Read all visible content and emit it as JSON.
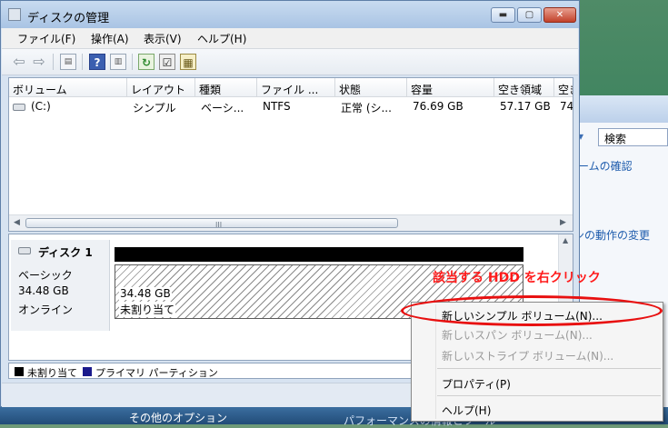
{
  "window": {
    "title": "ディスクの管理",
    "controls": {
      "minimize": "▬",
      "maximize": "▢",
      "close": "✕"
    }
  },
  "menu": [
    "ファイル(F)",
    "操作(A)",
    "表示(V)",
    "ヘルプ(H)"
  ],
  "toolbar": {
    "icons": [
      "back-icon",
      "forward-icon",
      "list-view-icon",
      "help-icon",
      "panel-icon",
      "refresh-icon",
      "properties-icon",
      "disk-icon"
    ]
  },
  "volume_list": {
    "columns": [
      "ボリューム",
      "レイアウト",
      "種類",
      "ファイル ...",
      "状態",
      "容量",
      "空き領域",
      "空き"
    ],
    "rows": [
      {
        "volume": "(C:)",
        "layout": "シンプル",
        "type": "ベーシ...",
        "fs": "NTFS",
        "status": "正常 (シ...",
        "capacity": "76.69 GB",
        "free": "57.17 GB",
        "pct": "74"
      }
    ],
    "scroll_grip": "III"
  },
  "disk": {
    "name": "ディスク 1",
    "type": "ベーシック",
    "size": "34.48 GB",
    "status": "オンライン",
    "region_size": "34.48 GB",
    "region_label": "未割り当て"
  },
  "legend": [
    {
      "label": "未割り当て",
      "color": "#000000"
    },
    {
      "label": "プライマリ パーティション",
      "color": "#1a1a8c"
    }
  ],
  "annotation": "該当する HDD を右クリック",
  "context_menu": [
    {
      "label": "新しいシンプル ボリューム(N)...",
      "enabled": true
    },
    {
      "label": "新しいスパン ボリューム(N)...",
      "enabled": false
    },
    {
      "label": "新しいストライプ ボリューム(N)...",
      "enabled": false
    },
    {
      "label": "プロパティ(P)",
      "enabled": true
    },
    {
      "label": "ヘルプ(H)",
      "enabled": true
    }
  ],
  "background": {
    "search_placeholder": "検索",
    "links": [
      "ームの確認",
      "ンの動作の変更"
    ],
    "bottom_option": "その他のオプション",
    "bottom_perf": "パフォーマンスの情報とツール"
  }
}
